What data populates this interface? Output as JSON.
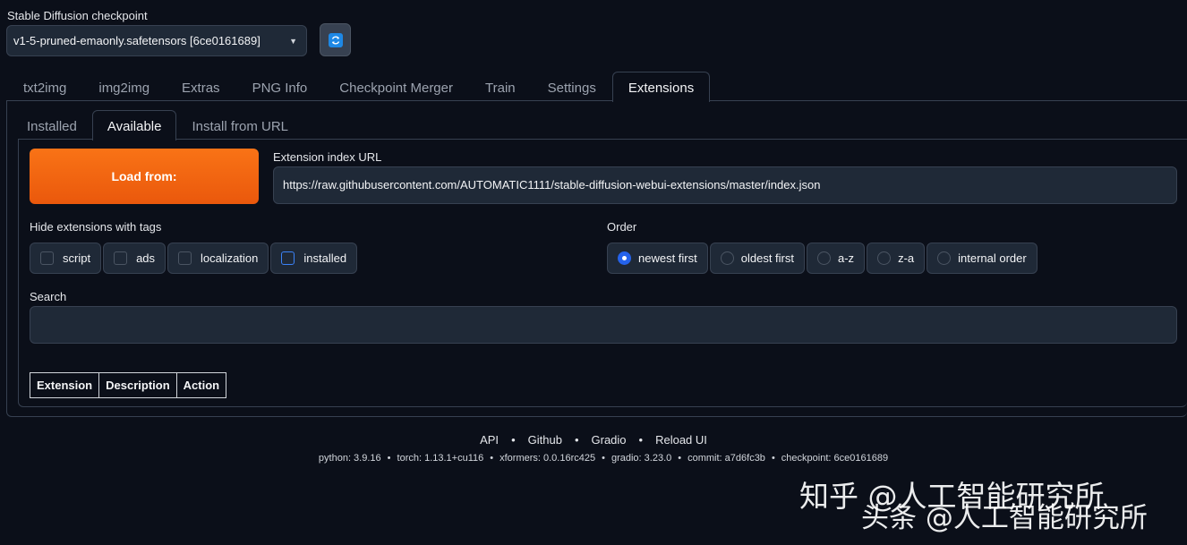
{
  "checkpoint": {
    "label": "Stable Diffusion checkpoint",
    "selected": "v1-5-pruned-emaonly.safetensors [6ce0161689]"
  },
  "main_tabs": [
    {
      "label": "txt2img"
    },
    {
      "label": "img2img"
    },
    {
      "label": "Extras"
    },
    {
      "label": "PNG Info"
    },
    {
      "label": "Checkpoint Merger"
    },
    {
      "label": "Train"
    },
    {
      "label": "Settings"
    },
    {
      "label": "Extensions"
    }
  ],
  "sub_tabs": [
    {
      "label": "Installed"
    },
    {
      "label": "Available"
    },
    {
      "label": "Install from URL"
    }
  ],
  "available": {
    "load_button": "Load from:",
    "url_label": "Extension index URL",
    "url_value": "https://raw.githubusercontent.com/AUTOMATIC1111/stable-diffusion-webui-extensions/master/index.json",
    "hide_label": "Hide extensions with tags",
    "tags": [
      {
        "label": "script"
      },
      {
        "label": "ads"
      },
      {
        "label": "localization"
      },
      {
        "label": "installed"
      }
    ],
    "order_label": "Order",
    "orders": [
      {
        "label": "newest first"
      },
      {
        "label": "oldest first"
      },
      {
        "label": "a-z"
      },
      {
        "label": "z-a"
      },
      {
        "label": "internal order"
      }
    ],
    "selected_order": "newest first",
    "search_label": "Search",
    "search_value": "",
    "table_headers": [
      "Extension",
      "Description",
      "Action"
    ]
  },
  "footer": {
    "links": [
      "API",
      "Github",
      "Gradio",
      "Reload UI"
    ],
    "versions": [
      "python: 3.9.16",
      "torch: 1.13.1+cu116",
      "xformers: 0.0.16rc425",
      "gradio: 3.23.0",
      "commit: a7d6fc3b",
      "checkpoint: 6ce0161689"
    ]
  },
  "watermark": {
    "line1": "知乎 @人工智能研究所",
    "line2": "头条 @人工智能研究所"
  },
  "colors": {
    "accent": "#ea580c",
    "background": "#0b0f19",
    "radio_selected": "#2563eb"
  },
  "icons": {
    "refresh": "refresh-icon",
    "dropdown": "chevron-down-icon"
  }
}
